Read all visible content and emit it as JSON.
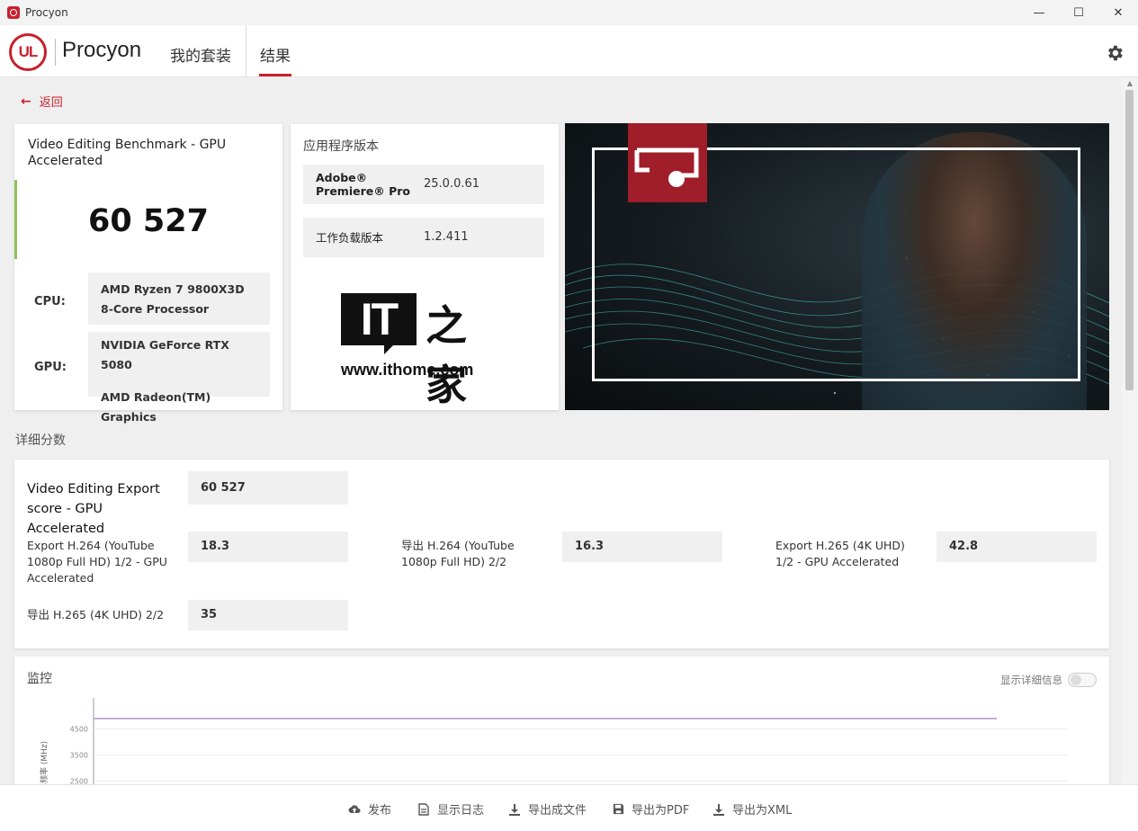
{
  "window": {
    "title": "Procyon",
    "controls": [
      "—",
      "☐",
      "✕"
    ]
  },
  "header": {
    "logo_text": "UL",
    "brand": "Procyon",
    "tabs": [
      {
        "label": "我的套装"
      },
      {
        "label": "结果"
      }
    ]
  },
  "back": {
    "label": "返回"
  },
  "benchmark": {
    "title": "Video Editing Benchmark - GPU Accelerated",
    "score": "60 527",
    "cpu_label": "CPU:",
    "cpu_value": "AMD Ryzen 7 9800X3D 8-Core Processor",
    "gpu_label": "GPU:",
    "gpu_values": [
      "NVIDIA GeForce RTX 5080",
      "AMD Radeon(TM) Graphics"
    ]
  },
  "versions": {
    "title": "应用程序版本",
    "rows": [
      {
        "name_line1": "Adobe®",
        "name_line2": "Premiere® Pro",
        "value": "25.0.0.61"
      },
      {
        "name": "工作负载版本",
        "value": "1.2.411"
      }
    ],
    "watermark_it": "IT",
    "watermark_cn": "之家",
    "watermark_url": "www.ithome.com"
  },
  "details": {
    "heading": "详细分数",
    "main_label": "Video Editing Export score - GPU Accelerated",
    "main_value": "60 527",
    "items": [
      {
        "label": "Export H.264 (YouTube 1080p Full HD) 1/2 - GPU Accelerated",
        "value": "18.3"
      },
      {
        "label": "导出 H.264 (YouTube 1080p Full HD) 2/2",
        "value": "16.3"
      },
      {
        "label": "Export H.265 (4K UHD) 1/2 - GPU Accelerated",
        "value": "42.8"
      },
      {
        "label": "导出 H.265 (4K UHD) 2/2",
        "value": "35"
      }
    ]
  },
  "monitor": {
    "title": "监控",
    "detail_toggle_label": "显示详细信息",
    "chart_data": {
      "type": "line",
      "ylabel": "率频率 (MHz)",
      "yticks": [
        2500,
        3500,
        4500
      ],
      "ylim": [
        2500,
        5000
      ],
      "series": [
        {
          "values": [
            4900,
            4900,
            4900,
            4900,
            4900,
            4900,
            4900,
            4900,
            4900,
            4900,
            4900
          ]
        }
      ],
      "colors": {
        "line": "#b99ac9",
        "grid": "#ececec"
      }
    }
  },
  "actions": [
    {
      "icon": "cloud-upload-icon",
      "label": "发布"
    },
    {
      "icon": "document-icon",
      "label": "显示日志"
    },
    {
      "icon": "download-icon",
      "label": "导出成文件"
    },
    {
      "icon": "save-icon",
      "label": "导出为PDF"
    },
    {
      "icon": "download-icon",
      "label": "导出为XML"
    }
  ],
  "colors": {
    "accent": "#c8202f",
    "score_bar": "#8fc25a",
    "badge": "#a01d2a"
  }
}
